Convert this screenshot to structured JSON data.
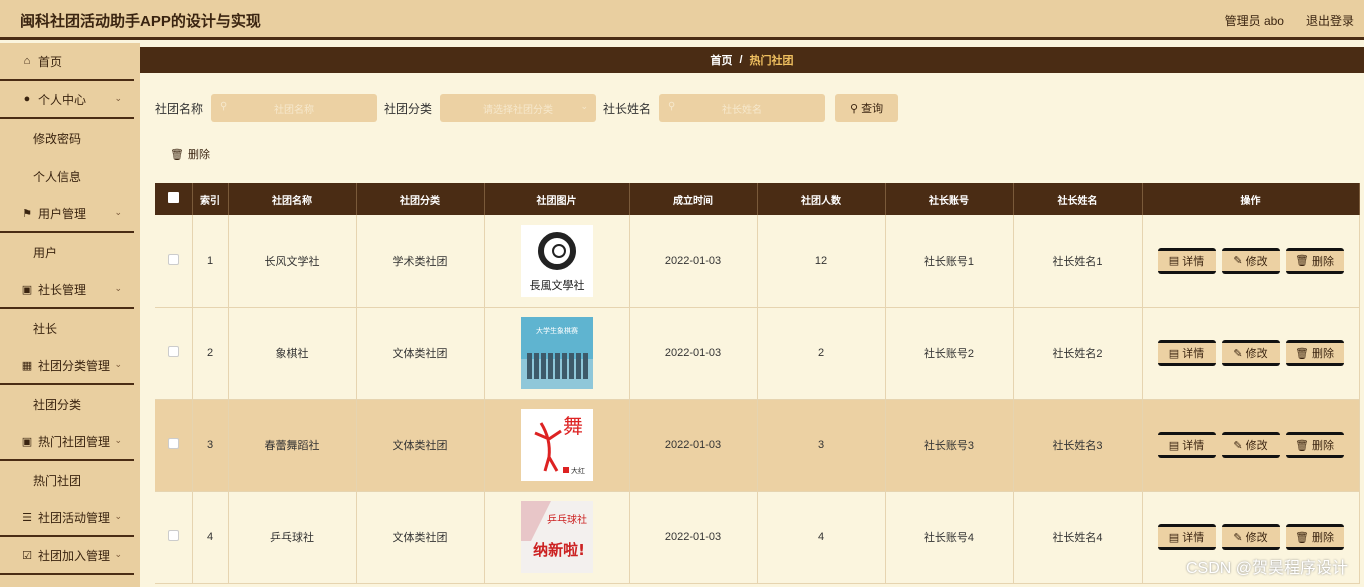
{
  "app": {
    "title": "闽科社团活动助手APP的设计与实现"
  },
  "header": {
    "user_label": "管理员 abo",
    "logout_label": "退出登录"
  },
  "sidebar": {
    "items": [
      {
        "type": "menu",
        "label": "首页",
        "icon": "home-icon",
        "chevron": false
      },
      {
        "type": "menu",
        "label": "个人中心",
        "icon": "user-icon",
        "chevron": true
      },
      {
        "type": "sub",
        "label": "修改密码"
      },
      {
        "type": "sub",
        "label": "个人信息"
      },
      {
        "type": "menu",
        "label": "用户管理",
        "icon": "flag-icon",
        "chevron": true
      },
      {
        "type": "sub",
        "label": "用户"
      },
      {
        "type": "menu",
        "label": "社长管理",
        "icon": "clipboard-icon",
        "chevron": true
      },
      {
        "type": "sub",
        "label": "社长"
      },
      {
        "type": "menu",
        "label": "社团分类管理",
        "icon": "grid-icon",
        "chevron": true
      },
      {
        "type": "sub",
        "label": "社团分类"
      },
      {
        "type": "menu",
        "label": "热门社团管理",
        "icon": "clipboard-icon",
        "chevron": true
      },
      {
        "type": "sub",
        "label": "热门社团"
      },
      {
        "type": "menu",
        "label": "社团活动管理",
        "icon": "list-icon",
        "chevron": true
      },
      {
        "type": "menu",
        "label": "社团加入管理",
        "icon": "checkbox-icon",
        "chevron": true
      }
    ]
  },
  "breadcrumb": {
    "home": "首页",
    "separator": "/",
    "current": "热门社团"
  },
  "search": {
    "name_label": "社团名称",
    "name_placeholder": "社团名称",
    "category_label": "社团分类",
    "category_placeholder": "请选择社团分类",
    "leader_label": "社长姓名",
    "leader_placeholder": "社长姓名",
    "query_label": "查询"
  },
  "toolbar": {
    "delete_label": "删除"
  },
  "table": {
    "columns": [
      "索引",
      "社团名称",
      "社团分类",
      "社团图片",
      "成立时间",
      "社团人数",
      "社长账号",
      "社长姓名",
      "操作"
    ],
    "rows": [
      {
        "index": "1",
        "name": "长风文学社",
        "category": "学术类社团",
        "image": "changfeng-logo",
        "date": "2022-01-03",
        "members": "12",
        "account": "社长账号1",
        "leader": "社长姓名1"
      },
      {
        "index": "2",
        "name": "象棋社",
        "category": "文体类社团",
        "image": "chess-photo",
        "date": "2022-01-03",
        "members": "2",
        "account": "社长账号2",
        "leader": "社长姓名2"
      },
      {
        "index": "3",
        "name": "春蕾舞蹈社",
        "category": "文体类社团",
        "image": "dance-poster",
        "date": "2022-01-03",
        "members": "3",
        "account": "社长账号3",
        "leader": "社长姓名3"
      },
      {
        "index": "4",
        "name": "乒乓球社",
        "category": "文体类社团",
        "image": "pingpong-poster",
        "date": "2022-01-03",
        "members": "4",
        "account": "社长账号4",
        "leader": "社长姓名4"
      }
    ],
    "actions": {
      "detail": "详情",
      "edit": "修改",
      "delete": "删除"
    },
    "image_texts": {
      "changfeng": "長風文學社",
      "chess": "大学生象棋赛",
      "dance_char": "舞",
      "dance_tag": "大红",
      "pingpong_top": "乒乓球社",
      "pingpong_big": "纳新啦!"
    }
  },
  "watermark": "CSDN @贺昊程序设计",
  "colors": {
    "header_bg": "#e9cfa0",
    "dark_brown": "#4a2c14",
    "content_bg": "#fbf5de",
    "accent": "#ecd1a3",
    "crumb_current": "#f0c060"
  }
}
